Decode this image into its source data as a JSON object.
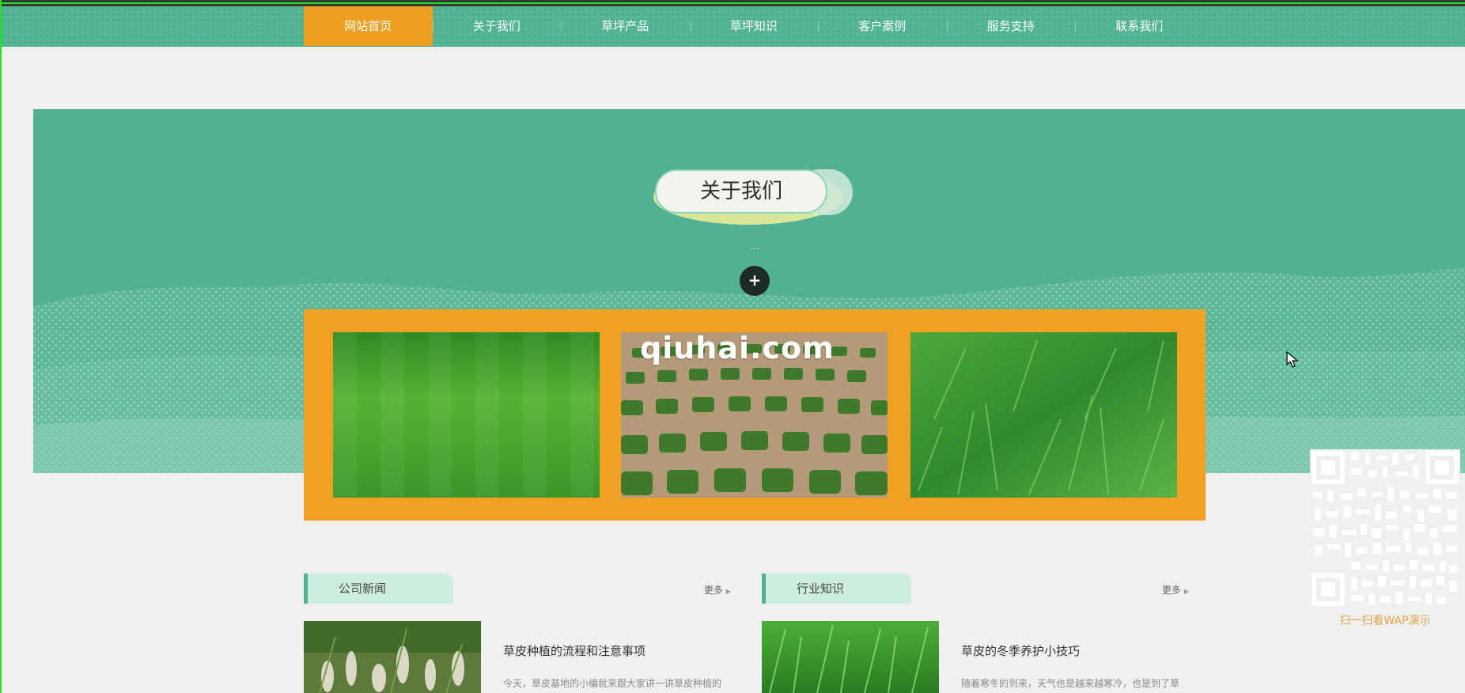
{
  "nav": {
    "items": [
      {
        "label": "网站首页",
        "active": true
      },
      {
        "label": "关于我们",
        "active": false
      },
      {
        "label": "草坪产品",
        "active": false
      },
      {
        "label": "草坪知识",
        "active": false
      },
      {
        "label": "客户案例",
        "active": false
      },
      {
        "label": "服务支持",
        "active": false
      },
      {
        "label": "联系我们",
        "active": false
      }
    ]
  },
  "hero": {
    "title": "关于我们",
    "dots": "...",
    "plus": "+"
  },
  "gallery": {
    "watermark": "qiuhai.com"
  },
  "sections": {
    "company_news": {
      "title": "公司新闻",
      "more": "更多",
      "item": {
        "title": "草皮种植的流程和注意事项",
        "desc": "今天，草皮基地的小编就来跟大家讲一讲草皮种植的"
      }
    },
    "industry": {
      "title": "行业知识",
      "more": "更多",
      "item": {
        "title": "草皮的冬季养护小技巧",
        "desc": "随着寒冬的到来，天气也是越来越寒冷，也是到了草"
      }
    }
  },
  "qr": {
    "label": "扫一扫看WAP演示"
  },
  "colors": {
    "nav_green": "#54b597",
    "accent_orange": "#f0a020",
    "hero_green": "#52b192",
    "page_bg": "#f0f0f0"
  }
}
